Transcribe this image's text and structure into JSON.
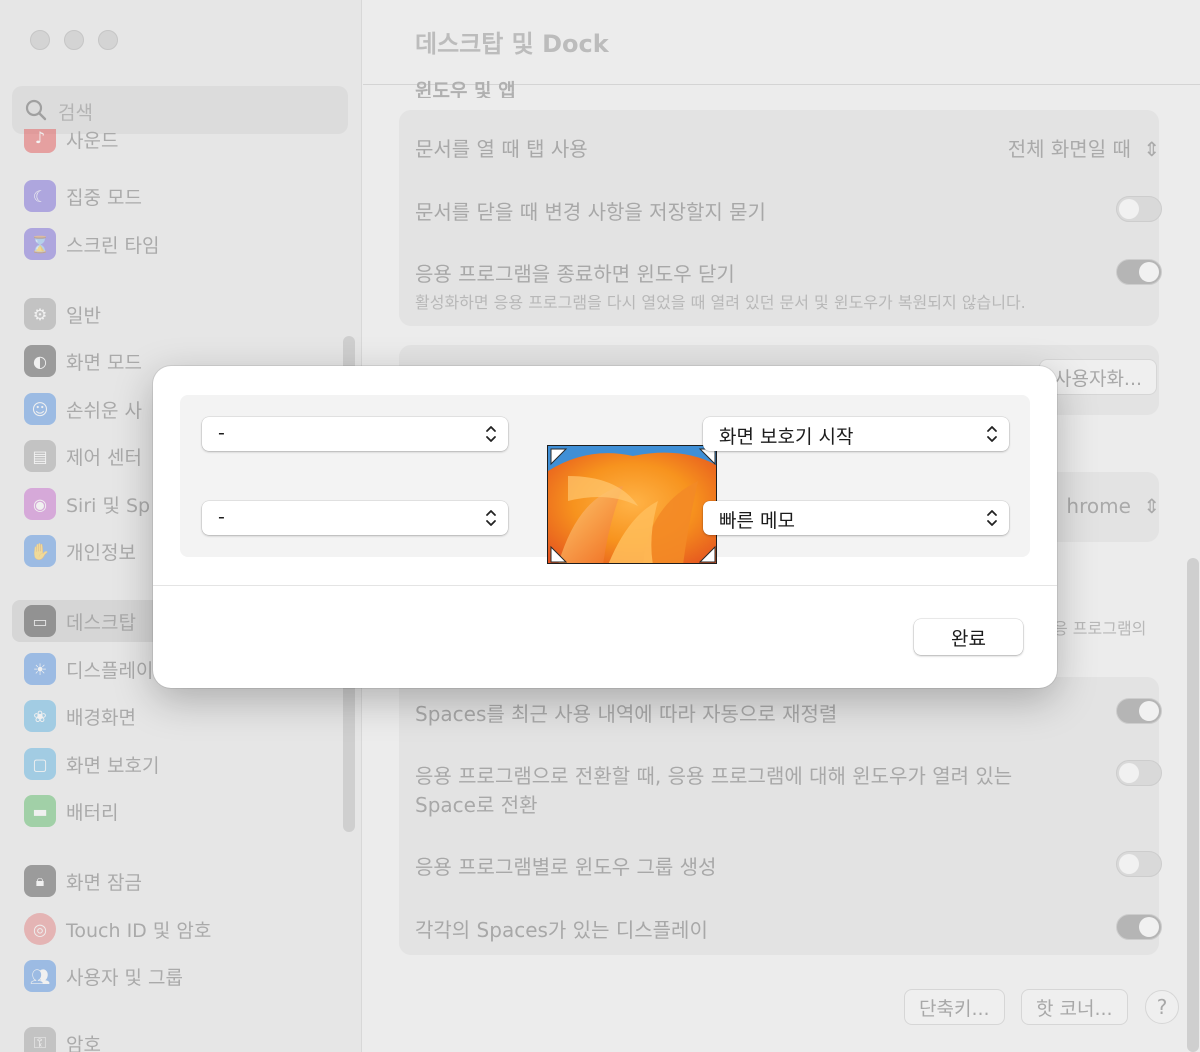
{
  "search": {
    "placeholder": "검색"
  },
  "sidebar": {
    "items": [
      {
        "label": "사운드",
        "icon": "speaker-icon",
        "color": "#e35a5a"
      },
      {
        "label": "집중 모드",
        "icon": "moon-icon",
        "color": "#6b5ad6"
      },
      {
        "label": "스크린 타임",
        "icon": "hourglass-icon",
        "color": "#6b5ad6"
      },
      {
        "label": "일반",
        "icon": "gear-icon",
        "color": "#9a9a9a"
      },
      {
        "label": "화면 모드",
        "icon": "appearance-icon",
        "color": "#2d2d2d"
      },
      {
        "label": "손쉬운 사",
        "icon": "accessibility-icon",
        "color": "#2f7de1"
      },
      {
        "label": "제어 센터",
        "icon": "control-center-icon",
        "color": "#9a9a9a"
      },
      {
        "label": "Siri 및 Sp",
        "icon": "siri-icon",
        "color": "#c04fc8"
      },
      {
        "label": "개인정보",
        "icon": "hand-icon",
        "color": "#2f7de1"
      },
      {
        "label": "데스크탑",
        "icon": "dock-icon",
        "color": "#2d2d2d",
        "selected": true
      },
      {
        "label": "디스플레이",
        "icon": "sun-icon",
        "color": "#2f7de1"
      },
      {
        "label": "배경화면",
        "icon": "flower-icon",
        "color": "#3ea6e0"
      },
      {
        "label": "화면 보호기",
        "icon": "screensaver-icon",
        "color": "#3ea6e0"
      },
      {
        "label": "배터리",
        "icon": "battery-icon",
        "color": "#3cb04a"
      },
      {
        "label": "화면 잠금",
        "icon": "lock-icon",
        "color": "#2d2d2d"
      },
      {
        "label": "Touch ID 및 암호",
        "icon": "fingerprint-icon",
        "color": "#e35a5a"
      },
      {
        "label": "사용자 및 그룹",
        "icon": "users-icon",
        "color": "#2f7de1"
      },
      {
        "label": "암호",
        "icon": "key-icon",
        "color": "#9a9a9a"
      }
    ]
  },
  "main": {
    "title": "데스크탑 및 Dock",
    "section_heading_cut": "윈도우 및 앱",
    "rows": {
      "tabs_label": "문서를 열 때 탭 사용",
      "tabs_value": "전체 화면일 때",
      "ask_save_label": "문서를 닫을 때 변경 사항을 저장할지 묻기",
      "close_windows_label": "응용 프로그램을 종료하면 윈도우 닫기",
      "close_windows_sub": "활성화하면 응용 프로그램을 다시 열었을 때 열려 있던 문서 및 윈도우가 복원되지 않습니다.",
      "customize_label": "사용자화...",
      "browser_value": "hrome",
      "apps_sub_cut": "응 프로그램의",
      "spaces_reorder_label": "Spaces를 최근 사용 내역에 따라 자동으로 재정렬",
      "switch_space_label_1": "응용 프로그램으로 전환할 때, 응용 프로그램에 대해 윈도우가 열려 있는",
      "switch_space_label_2": "Space로 전환",
      "group_windows_label": "응용 프로그램별로 윈도우 그룹 생성",
      "separate_spaces_label": "각각의 Spaces가 있는 디스플레이"
    },
    "toggles": {
      "ask_save": false,
      "close_windows": true,
      "spaces_reorder": true,
      "switch_space": false,
      "group_windows": false,
      "separate_spaces": true
    },
    "buttons": {
      "shortcuts": "단축키...",
      "hot_corners": "핫 코너...",
      "help": "?"
    }
  },
  "modal": {
    "top_left": "-",
    "bottom_left": "-",
    "top_right": "화면 보호기 시작",
    "bottom_right": "빠른 메모",
    "done": "완료"
  }
}
